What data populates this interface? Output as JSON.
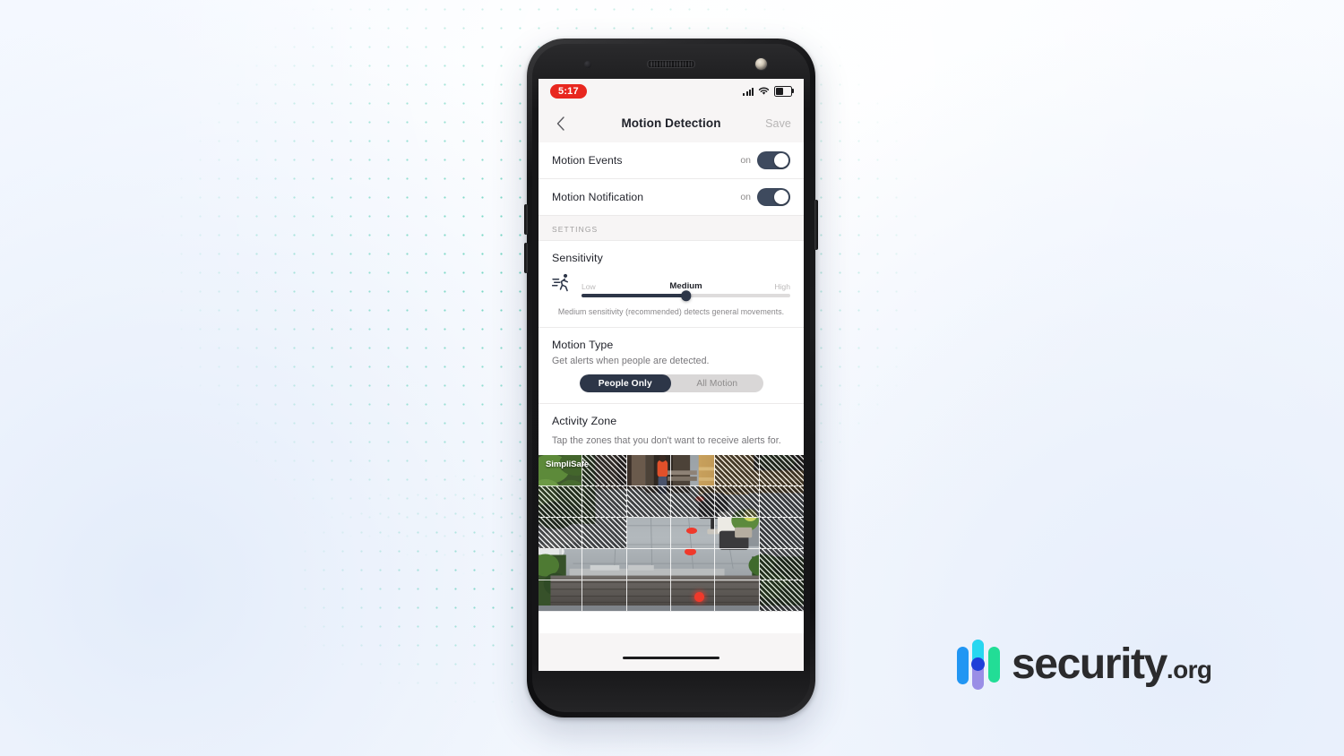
{
  "brand": {
    "name": "security",
    "tld": ".org",
    "bar_colors": [
      "#2196f3",
      "#27d7f0",
      "#9a8ee6",
      "#1f3fd8",
      "#22dd96"
    ]
  },
  "phone": {
    "status_bar": {
      "time": "5:17",
      "time_pill_color": "#e8271f",
      "icons": [
        "signal-icon",
        "wifi-icon",
        "battery-icon"
      ],
      "battery_level": "42"
    },
    "nav": {
      "back_icon": "chevron-left-icon",
      "title": "Motion Detection",
      "save_label": "Save"
    },
    "rows": [
      {
        "label": "Motion Events",
        "state_label": "on",
        "state": "on"
      },
      {
        "label": "Motion Notification",
        "state_label": "on",
        "state": "on"
      }
    ],
    "settings_header": "SETTINGS",
    "sensitivity": {
      "title": "Sensitivity",
      "icon": "running-person-icon",
      "labels": {
        "low": "Low",
        "medium": "Medium",
        "high": "High"
      },
      "value": "Medium",
      "percent": "50",
      "note": "Medium sensitivity (recommended) detects general movements.",
      "track_color": "#2d3648"
    },
    "motion_type": {
      "title": "Motion Type",
      "subtitle": "Get alerts when people are detected.",
      "options": [
        {
          "label": "People Only",
          "selected": true
        },
        {
          "label": "All Motion",
          "selected": false
        }
      ]
    },
    "activity_zone": {
      "title": "Activity Zone",
      "subtitle": "Tap the zones that you don't want to receive alerts for.",
      "watermark": "SimpliSafe",
      "grid": {
        "columns": 6,
        "rows": 5
      },
      "disabled_cells": [
        1,
        4,
        5,
        6,
        7,
        8,
        9,
        10,
        11,
        12,
        13,
        17,
        23,
        29
      ]
    },
    "home_indicator": "home-indicator"
  }
}
